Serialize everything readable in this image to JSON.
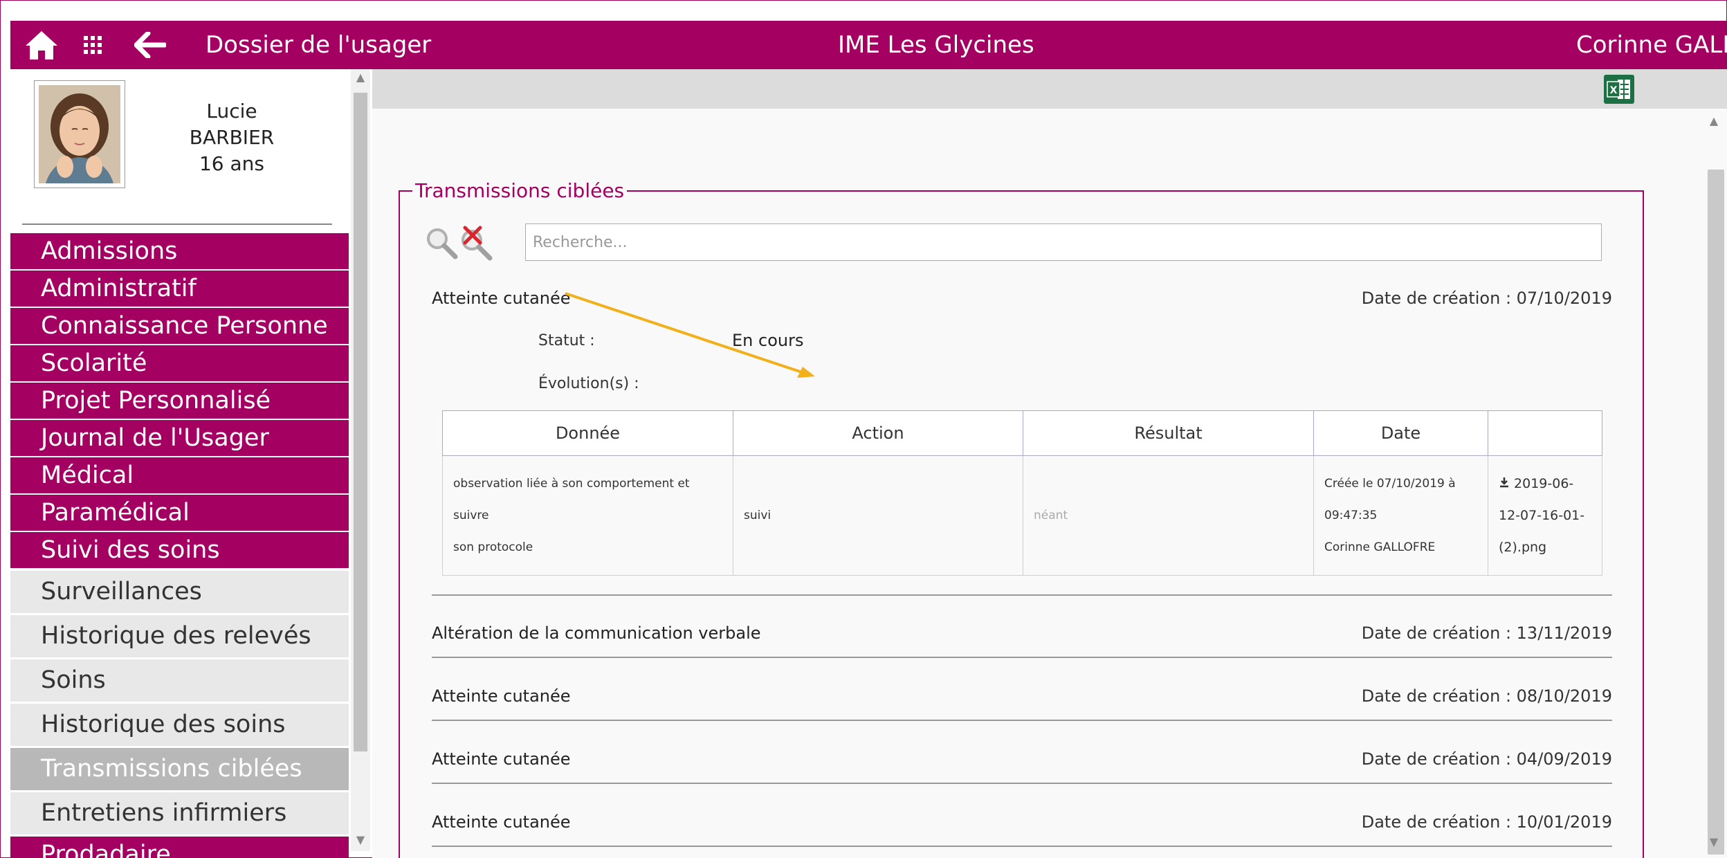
{
  "topbar": {
    "title": "Dossier de l'usager",
    "organization": "IME Les Glycines",
    "user": "Corinne GALLC"
  },
  "patient": {
    "first_name": "Lucie",
    "last_name": "BARBIER",
    "age": "16 ans"
  },
  "menu": {
    "items": [
      {
        "label": "Admissions"
      },
      {
        "label": "Administratif"
      },
      {
        "label": "Connaissance Personne"
      },
      {
        "label": "Scolarité"
      },
      {
        "label": "Projet Personnalisé"
      },
      {
        "label": "Journal de l'Usager"
      },
      {
        "label": "Médical"
      },
      {
        "label": "Paramédical"
      },
      {
        "label": "Suivi des soins"
      }
    ],
    "subitems": [
      {
        "label": "Surveillances"
      },
      {
        "label": "Historique des relevés"
      },
      {
        "label": "Soins"
      },
      {
        "label": "Historique des soins"
      },
      {
        "label": "Transmissions ciblées",
        "active": true
      },
      {
        "label": "Entretiens infirmiers"
      }
    ],
    "last_partial": "Prodadaire"
  },
  "main": {
    "section_title": "Transmissions ciblées",
    "search_placeholder": "Recherche...",
    "entries": [
      {
        "title": "Atteinte cutanée",
        "date": "Date de création : 07/10/2019"
      },
      {
        "title": "Altération de la communication verbale",
        "date": "Date de création : 13/11/2019"
      },
      {
        "title": "Atteinte cutanée",
        "date": "Date de création : 08/10/2019"
      },
      {
        "title": "Atteinte cutanée",
        "date": "Date de création : 04/09/2019"
      },
      {
        "title": "Atteinte cutanée",
        "date": "Date de création : 10/01/2019"
      }
    ],
    "detail": {
      "status_label": "Statut :",
      "status_value": "En cours",
      "evolution_label": "Évolution(s) :",
      "table": {
        "headers": [
          "Donnée",
          "Action",
          "Résultat",
          "Date",
          ""
        ],
        "row": {
          "donnee_line1": "observation liée à son comportement et suivre",
          "donnee_line2": "son protocole",
          "action": "suivi",
          "resultat": "néant",
          "date_line1": "Créée le 07/10/2019 à",
          "date_line2": "09:47:35",
          "date_line3": "Corinne GALLOFRE",
          "file_line1": "2019-06-",
          "file_line2": "12-07-16-01-",
          "file_line3": "(2).png"
        }
      }
    }
  },
  "colors": {
    "brand": "#a30062",
    "excel": "#1d7044",
    "annotation_arrow": "#f2b11b"
  },
  "icons": [
    "home-icon",
    "apps-grid-icon",
    "back-arrow-icon",
    "excel-export-icon",
    "search-icon",
    "clear-search-icon",
    "download-icon"
  ]
}
